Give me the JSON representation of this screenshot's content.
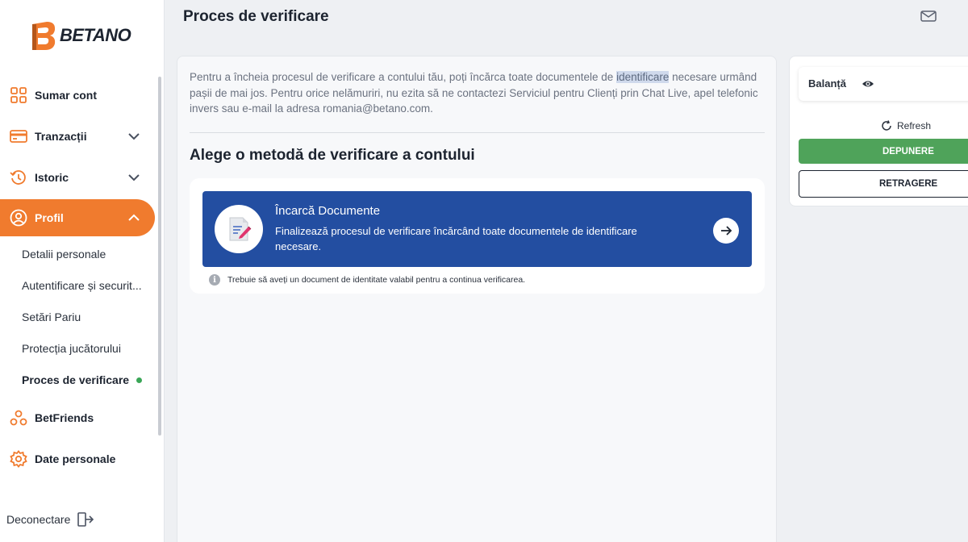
{
  "brand": {
    "name": "BETANO"
  },
  "sidebar": {
    "items": [
      {
        "label": "Sumar cont",
        "icon": "grid-icon"
      },
      {
        "label": "Tranzacții",
        "icon": "card-icon"
      },
      {
        "label": "Istoric",
        "icon": "history-icon"
      },
      {
        "label": "Profil",
        "icon": "user-icon"
      },
      {
        "label": "BetFriends",
        "icon": "friends-icon"
      },
      {
        "label": "Date personale",
        "icon": "gear-icon"
      }
    ],
    "sub_items": [
      {
        "label": "Detalii personale"
      },
      {
        "label": "Autentificare și securit..."
      },
      {
        "label": "Setări Pariu"
      },
      {
        "label": "Protecția jucătorului"
      },
      {
        "label": "Proces de verificare"
      }
    ],
    "logout_label": "Deconectare"
  },
  "header": {
    "title": "Proces de verificare"
  },
  "main": {
    "intro_before": "Pentru a încheia procesul de verificare a contului tău, poți încărca toate documentele de ",
    "intro_highlight": "identificare",
    "intro_after": " necesare urmând pașii de mai jos. Pentru orice nelămuriri, nu ezita să ne contactezi Serviciul pentru Clienți prin Chat Live, apel telefonic invers sau e-mail la adresa romania@betano.com.",
    "section_title": "Alege o metodă de verificare a contului",
    "method": {
      "title": "Încarcă Documente",
      "description": "Finalizează procesul de verificare încărcând toate documentele de identificare necesare."
    },
    "note": "Trebuie să aveți un document de identitate valabil pentru a continua verificarea."
  },
  "right_panel": {
    "balance_label": "Balanță",
    "refresh_label": "Refresh",
    "deposit_label": "DEPUNERE",
    "withdraw_label": "RETRAGERE"
  },
  "colors": {
    "accent": "#f07b2e",
    "primary_blue": "#234ea1",
    "success_green": "#4fa35a"
  }
}
